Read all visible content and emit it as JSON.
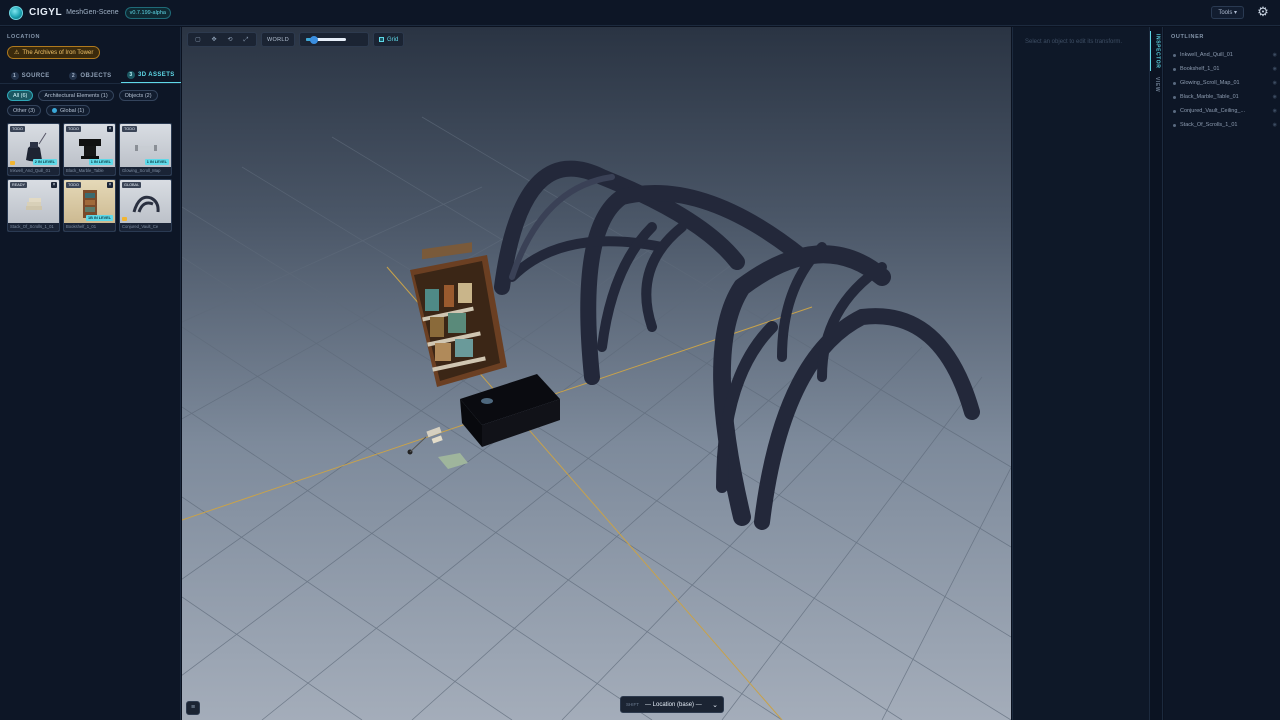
{
  "app": {
    "name": "CIGYL",
    "subtitle": "MeshGen-Scene",
    "version": "v0.7.199-alpha",
    "tools_label": "Tools ▾"
  },
  "left": {
    "location_label": "LOCATION",
    "location_value": "The Archives of Iron Tower",
    "tabs": [
      {
        "num": "1",
        "label": "SOURCE"
      },
      {
        "num": "2",
        "label": "OBJECTS"
      },
      {
        "num": "3",
        "label": "3D ASSETS"
      }
    ],
    "filters": [
      {
        "label": "All (6)",
        "active": true
      },
      {
        "label": "Architectural Elements (1)",
        "active": false
      },
      {
        "label": "Objects (2)",
        "active": false
      },
      {
        "label": "Other (3)",
        "active": false
      },
      {
        "label": "Global (1)",
        "active": false
      }
    ],
    "assets": [
      {
        "state": "TODO",
        "level": "2 IN LEVEL",
        "caption": "Inkwell_And_Quill_01"
      },
      {
        "state": "TODO",
        "level": "1 IN LEVEL",
        "caption": "Black_Marble_Table"
      },
      {
        "state": "TODO",
        "level": "1 IN LEVEL",
        "caption": "Glowing_Scroll_Map"
      },
      {
        "state": "READY",
        "level": "",
        "caption": "Stack_Of_Scrolls_1_01"
      },
      {
        "state": "TODO",
        "level": "1B IN LEVEL",
        "caption": "Bookshelf_1_01"
      },
      {
        "state": "GLOBAL",
        "level": "",
        "caption": "Conjured_Vault_Ce"
      }
    ]
  },
  "viewport": {
    "world_label": "WORLD",
    "grid_label": "Grid",
    "shift_key": "SHIFT",
    "location_select": "— Location (base) —",
    "grid_on": true
  },
  "inspector": {
    "hint": "Select an object to edit its transform.",
    "tab_inspector": "INSPECTOR",
    "tab_view": "VIEW"
  },
  "outliner": {
    "title": "OUTLINER",
    "items": [
      "Inkwell_And_Quill_01",
      "Bookshelf_1_01",
      "Glowing_Scroll_Map_01",
      "Black_Marble_Table_01",
      "Conjured_Vault_Ceiling_...",
      "Stack_Of_Scrolls_1_01"
    ]
  },
  "colors": {
    "accent": "#5fd9e8",
    "location_chip": "#f2c46a",
    "panel_bg": "#0d1626"
  }
}
